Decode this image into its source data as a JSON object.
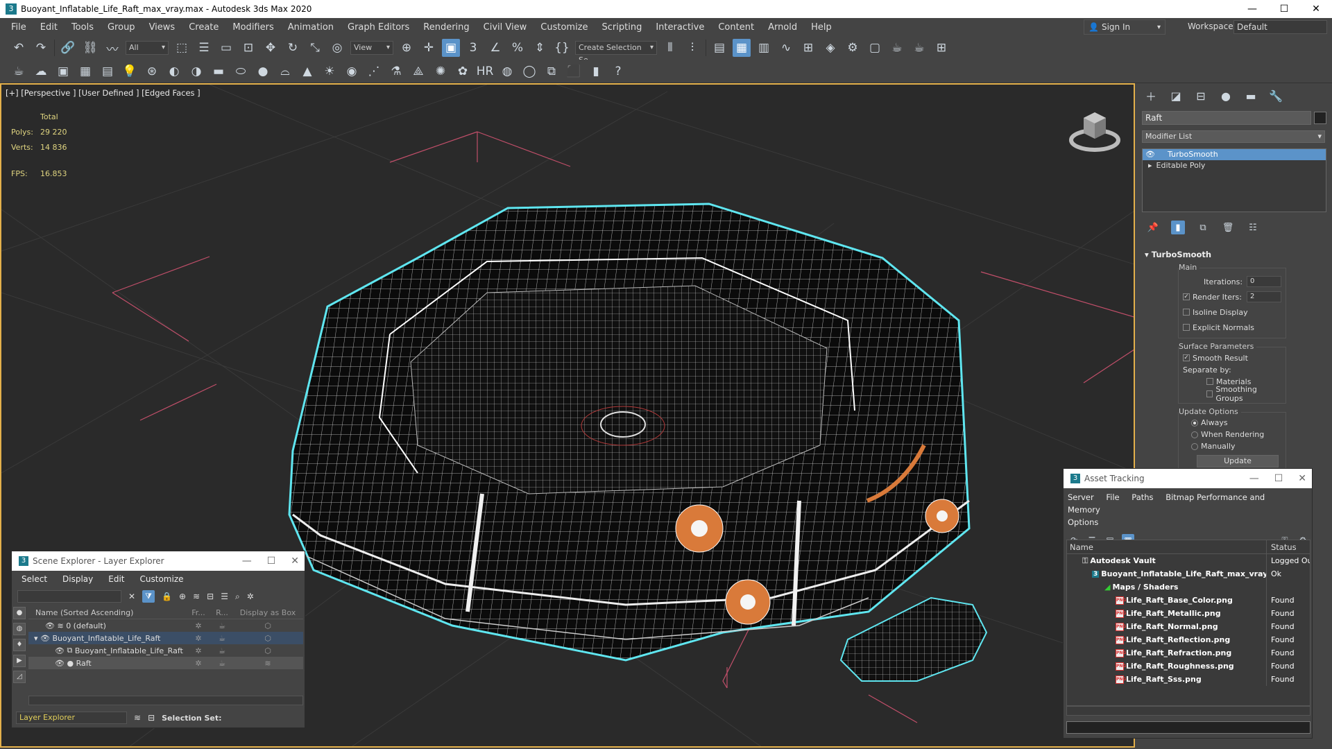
{
  "window": {
    "title": "Buoyant_Inflatable_Life_Raft_max_vray.max - Autodesk 3ds Max 2020",
    "app_icon": "3"
  },
  "menu": {
    "items": [
      "File",
      "Edit",
      "Tools",
      "Group",
      "Views",
      "Create",
      "Modifiers",
      "Animation",
      "Graph Editors",
      "Rendering",
      "Civil View",
      "Customize",
      "Scripting",
      "Interactive",
      "Content",
      "Arnold",
      "Help"
    ],
    "sign_in": "Sign In",
    "workspaces_label": "Workspaces:",
    "workspace_value": "Default"
  },
  "toolbar": {
    "filter_value": "All",
    "ref_coord_value": "View",
    "selection_set_value": "Create Selection Se"
  },
  "viewport": {
    "label": "[+] [Perspective ] [User Defined ] [Edged Faces ]",
    "stats_header": "Total",
    "polys_label": "Polys:",
    "polys_value": "29 220",
    "verts_label": "Verts:",
    "verts_value": "14 836",
    "fps_label": "FPS:",
    "fps_value": "16.853"
  },
  "command_panel": {
    "object_name": "Raft",
    "modifier_list": "Modifier List",
    "stack": [
      "TurboSmooth",
      "Editable Poly"
    ],
    "rollout_title": "TurboSmooth",
    "main_group": "Main",
    "iterations_label": "Iterations:",
    "iterations_value": "0",
    "render_iters_label": "Render Iters:",
    "render_iters_value": "2",
    "isoline_display": "Isoline Display",
    "explicit_normals": "Explicit Normals",
    "surface_params_group": "Surface Parameters",
    "smooth_result": "Smooth Result",
    "separate_by": "Separate by:",
    "materials": "Materials",
    "smoothing_groups": "Smoothing Groups",
    "update_options_group": "Update Options",
    "always": "Always",
    "when_rendering": "When Rendering",
    "manually": "Manually",
    "update_button": "Update"
  },
  "scene_explorer": {
    "title": "Scene Explorer - Layer Explorer",
    "menu": [
      "Select",
      "Display",
      "Edit",
      "Customize"
    ],
    "columns": [
      "Name (Sorted Ascending)",
      "Fr...",
      "R...",
      "Display as Box"
    ],
    "rows": [
      {
        "name": "0 (default)",
        "indent": 0
      },
      {
        "name": "Buoyant_Inflatable_Life_Raft",
        "indent": 0
      },
      {
        "name": "Buoyant_Inflatable_Life_Raft",
        "indent": 1
      },
      {
        "name": "Raft",
        "indent": 1
      }
    ],
    "layer_explorer": "Layer Explorer",
    "selection_set": "Selection Set:"
  },
  "asset_tracking": {
    "title": "Asset Tracking",
    "menu": [
      "Server",
      "File",
      "Paths",
      "Bitmap Performance and Memory",
      "Options"
    ],
    "columns": [
      "Name",
      "Status"
    ],
    "rows": [
      {
        "name": "Autodesk Vault",
        "status": "Logged Ou",
        "indent": 1,
        "icon": "vault"
      },
      {
        "name": "Buoyant_Inflatable_Life_Raft_max_vray.max",
        "status": "Ok",
        "indent": 2,
        "icon": "max"
      },
      {
        "name": "Maps / Shaders",
        "status": "",
        "indent": 3,
        "icon": "maps"
      },
      {
        "name": "Life_Raft_Base_Color.png",
        "status": "Found",
        "indent": 4,
        "icon": "png"
      },
      {
        "name": "Life_Raft_Metallic.png",
        "status": "Found",
        "indent": 4,
        "icon": "png"
      },
      {
        "name": "Life_Raft_Normal.png",
        "status": "Found",
        "indent": 4,
        "icon": "png"
      },
      {
        "name": "Life_Raft_Reflection.png",
        "status": "Found",
        "indent": 4,
        "icon": "png"
      },
      {
        "name": "Life_Raft_Refraction.png",
        "status": "Found",
        "indent": 4,
        "icon": "png"
      },
      {
        "name": "Life_Raft_Roughness.png",
        "status": "Found",
        "indent": 4,
        "icon": "png"
      },
      {
        "name": "Life_Raft_Sss.png",
        "status": "Found",
        "indent": 4,
        "icon": "png"
      }
    ]
  },
  "colors": {
    "selection_blue": "#5b93c9",
    "active_viewport_border": "#e3b04b",
    "wireframe_select": "#5fe6f0",
    "stats_yellow": "#e0d580"
  }
}
